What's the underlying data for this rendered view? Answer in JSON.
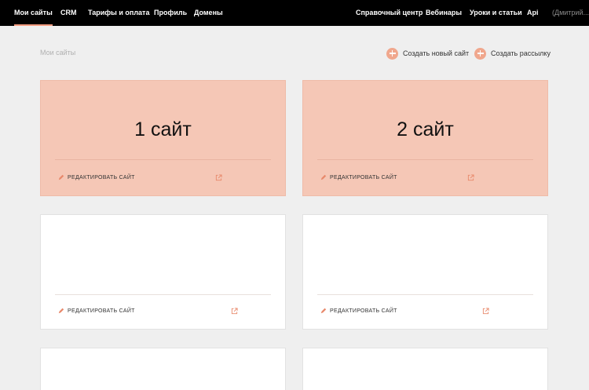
{
  "nav": {
    "left": [
      {
        "label": "Мои сайты",
        "active": true
      },
      {
        "label": "CRM"
      },
      {
        "label": "Тарифы и оплата"
      },
      {
        "label": "Профиль"
      },
      {
        "label": "Домены"
      }
    ],
    "right": [
      {
        "label": "Справочный центр"
      },
      {
        "label": "Вебинары"
      },
      {
        "label": "Уроки и статьи"
      },
      {
        "label": "Api"
      },
      {
        "label": "(Дмитрий...)"
      }
    ]
  },
  "page": {
    "title": "Мои сайты"
  },
  "actions": {
    "create_site": "Создать новый сайт",
    "create_mailing": "Создать рассылку"
  },
  "sites": [
    {
      "title": "1 сайт",
      "edit_label": "Редактировать сайт",
      "highlighted": true
    },
    {
      "title": "2 сайт",
      "edit_label": "Редактировать сайт",
      "highlighted": true
    },
    {
      "title": "",
      "edit_label": "Редактировать сайт",
      "highlighted": false
    },
    {
      "title": "",
      "edit_label": "Редактировать сайт",
      "highlighted": false
    },
    {
      "title": "",
      "edit_label": "",
      "highlighted": false
    },
    {
      "title": "",
      "edit_label": "",
      "highlighted": false
    }
  ],
  "colors": {
    "accent": "#f0a78d",
    "card_highlight": "#f5c7b6",
    "topbar": "#000000"
  },
  "icons": {
    "action": "plus-circle-icon",
    "edit": "pencil-icon",
    "open": "external-link-icon"
  }
}
